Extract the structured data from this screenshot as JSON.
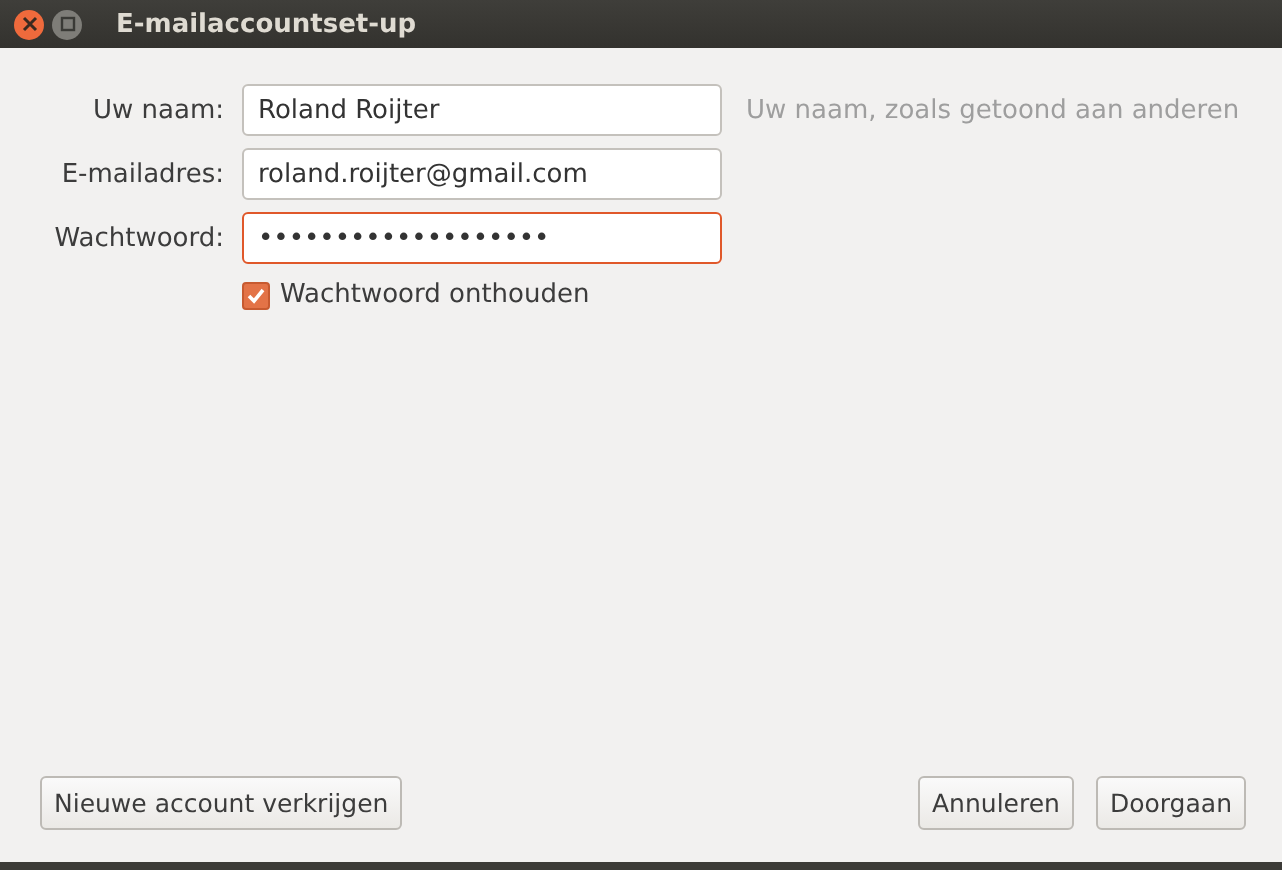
{
  "window": {
    "title": "E-mailaccountset-up"
  },
  "fields": [
    {
      "label": "Uw naam:",
      "value": "Roland Roijter",
      "focused": false,
      "hint": "Uw naam, zoals getoond aan anderen"
    },
    {
      "label": "E-mailadres:",
      "value": "roland.roijter@gmail.com",
      "focused": false
    },
    {
      "label": "Wachtwoord:",
      "value": "•••••••••••••••••••",
      "focused": true
    }
  ],
  "remember": {
    "label": "Wachtwoord onthouden",
    "checked": true
  },
  "left_buttons": [
    {
      "label": "Nieuwe account verkrijgen"
    }
  ],
  "right_buttons": [
    {
      "label": "Annuleren"
    },
    {
      "label": "Doorgaan"
    }
  ]
}
